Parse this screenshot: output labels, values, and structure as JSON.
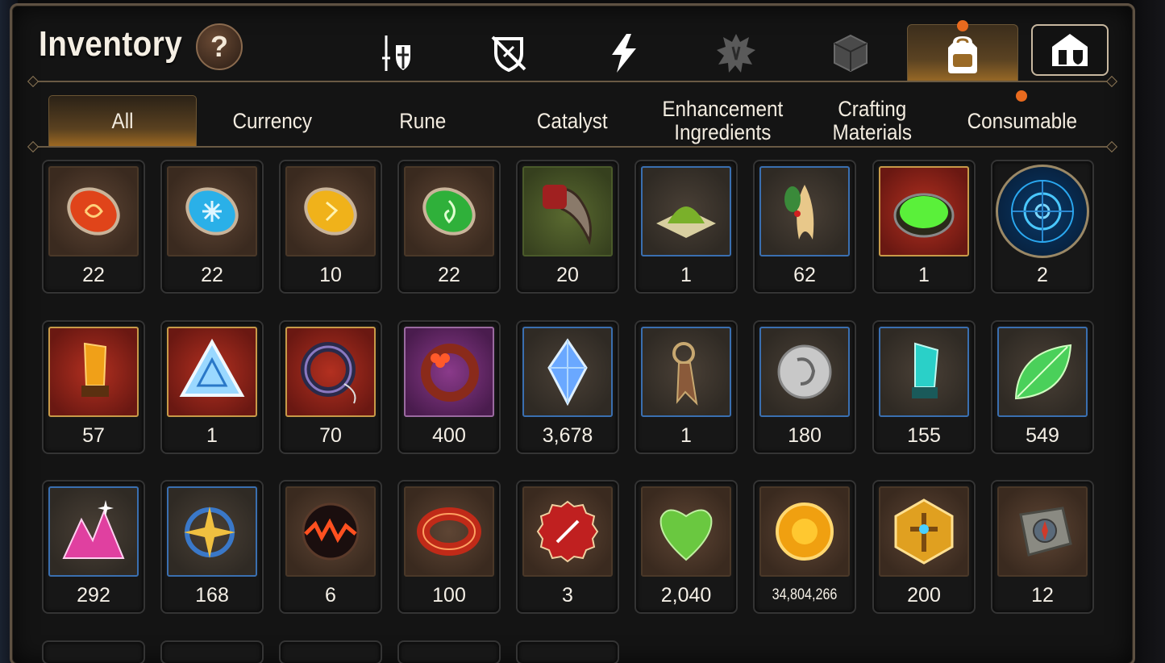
{
  "header": {
    "title": "Inventory",
    "help_label": "?"
  },
  "top_tabs": [
    {
      "name": "tab-equipment",
      "icon": "sword-shield-icon",
      "active": false,
      "badge": false
    },
    {
      "name": "tab-no-armor",
      "icon": "crossed-shield-icon",
      "active": false,
      "badge": false
    },
    {
      "name": "tab-skills",
      "icon": "lightning-icon",
      "active": false,
      "badge": false
    },
    {
      "name": "tab-emblems",
      "icon": "splat-emblem-icon",
      "active": false,
      "badge": false
    },
    {
      "name": "tab-dice",
      "icon": "dice-icon",
      "active": false,
      "badge": false
    },
    {
      "name": "tab-bag",
      "icon": "backpack-icon",
      "active": true,
      "badge": true
    },
    {
      "name": "tab-storage",
      "icon": "storage-house-icon",
      "active": false,
      "badge": false
    }
  ],
  "sub_tabs": [
    {
      "label": "All",
      "active": true,
      "badge": false
    },
    {
      "label": "Currency",
      "active": false,
      "badge": false
    },
    {
      "label": "Rune",
      "active": false,
      "badge": false
    },
    {
      "label": "Catalyst",
      "active": false,
      "badge": false
    },
    {
      "label": "Enhancement\nIngredients",
      "active": false,
      "badge": false
    },
    {
      "label": "Crafting\nMaterials",
      "active": false,
      "badge": false
    },
    {
      "label": "Consumable",
      "active": false,
      "badge": true
    }
  ],
  "items": [
    {
      "icon": "red-rune-stone-icon",
      "count": "22",
      "frame": "brown"
    },
    {
      "icon": "blue-rune-stone-icon",
      "count": "22",
      "frame": "brown"
    },
    {
      "icon": "yellow-rune-stone-icon",
      "count": "10",
      "frame": "brown"
    },
    {
      "icon": "green-rune-stone-icon",
      "count": "22",
      "frame": "brown"
    },
    {
      "icon": "beast-claw-icon",
      "count": "20",
      "frame": "green"
    },
    {
      "icon": "green-powder-icon",
      "count": "1",
      "frame": "blue"
    },
    {
      "icon": "ginseng-root-icon",
      "count": "62",
      "frame": "blue"
    },
    {
      "icon": "green-potion-cauldron-icon",
      "count": "1",
      "frame": "red"
    },
    {
      "icon": "blue-rune-circle-icon",
      "count": "2",
      "frame": "circle"
    },
    {
      "icon": "gold-crystal-icon",
      "count": "57",
      "frame": "red"
    },
    {
      "icon": "triangle-crystal-icon",
      "count": "1",
      "frame": "red"
    },
    {
      "icon": "medallion-ring-icon",
      "count": "70",
      "frame": "red"
    },
    {
      "icon": "flower-ring-icon",
      "count": "400",
      "frame": "purple"
    },
    {
      "icon": "blue-gem-icon",
      "count": "3,678",
      "frame": "blue"
    },
    {
      "icon": "bookmark-dagger-icon",
      "count": "1",
      "frame": "blue"
    },
    {
      "icon": "silver-coin-icon",
      "count": "180",
      "frame": "blue"
    },
    {
      "icon": "teal-crystal-icon",
      "count": "155",
      "frame": "blue"
    },
    {
      "icon": "green-leaf-icon",
      "count": "549",
      "frame": "blue"
    },
    {
      "icon": "pink-crystal-cluster-icon",
      "count": "292",
      "frame": "blue"
    },
    {
      "icon": "star-amulet-icon",
      "count": "168",
      "frame": "blue"
    },
    {
      "icon": "lava-orb-icon",
      "count": "6",
      "frame": "brown"
    },
    {
      "icon": "red-bracelet-icon",
      "count": "100",
      "frame": "brown"
    },
    {
      "icon": "bottle-cap-icon",
      "count": "3",
      "frame": "brown"
    },
    {
      "icon": "green-heart-icon",
      "count": "2,040",
      "frame": "brown"
    },
    {
      "icon": "gold-coin-icon",
      "count": "34,804,266",
      "frame": "brown"
    },
    {
      "icon": "gold-hexagon-emblem-icon",
      "count": "200",
      "frame": "brown"
    },
    {
      "icon": "stone-compass-icon",
      "count": "12",
      "frame": "brown"
    }
  ],
  "colors": {
    "accent": "#a06b22",
    "badge": "#e86a1e",
    "rare_frame": "#3a6fb0",
    "epic_frame": "#c89a48"
  }
}
